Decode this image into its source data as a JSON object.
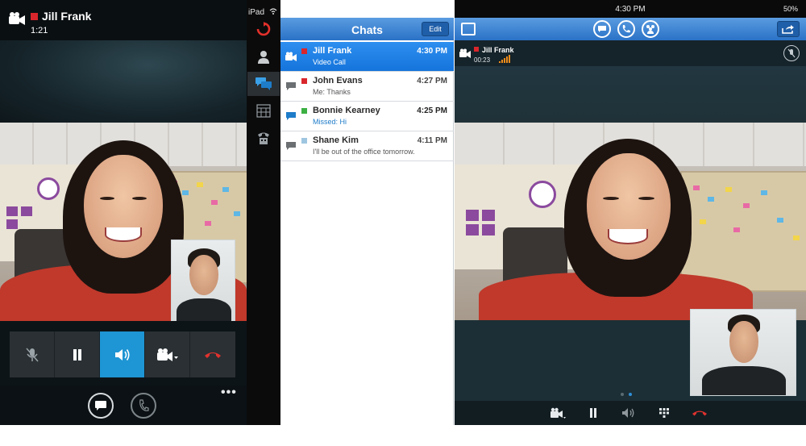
{
  "left_call": {
    "contact_name": "Jill Frank",
    "elapsed": "1:21",
    "status_color": "#d9262c",
    "controls": [
      {
        "id": "mute",
        "icon": "mic-muted-icon",
        "active": false
      },
      {
        "id": "hold",
        "icon": "pause-icon",
        "active": false
      },
      {
        "id": "speaker",
        "icon": "speaker-icon",
        "active": true
      },
      {
        "id": "video",
        "icon": "video-camera-icon",
        "active": false
      },
      {
        "id": "end",
        "icon": "end-call-icon",
        "active": false
      }
    ],
    "bottom": [
      {
        "id": "chat",
        "icon": "chat-bubble-icon"
      },
      {
        "id": "phone",
        "icon": "phone-icon"
      }
    ],
    "more_label": "•••"
  },
  "ipad_sidebar": {
    "device_label": "iPad",
    "items": [
      {
        "id": "refresh",
        "icon": "refresh-icon"
      },
      {
        "id": "contacts",
        "icon": "person-icon"
      },
      {
        "id": "chats",
        "icon": "chats-icon",
        "selected": true
      },
      {
        "id": "calendar",
        "icon": "calendar-icon"
      },
      {
        "id": "phone",
        "icon": "phone-icon"
      }
    ]
  },
  "chats": {
    "title": "Chats",
    "edit_label": "Edit",
    "rows": [
      {
        "name": "Jill Frank",
        "subtitle": "Video Call",
        "time": "4:30 PM",
        "status_color": "#d9262c",
        "icon": "video-camera-icon",
        "selected": true
      },
      {
        "name": "John Evans",
        "subtitle": "Me: Thanks",
        "time": "4:27 PM",
        "status_color": "#d9262c",
        "icon": "chat-bubble-icon",
        "selected": false
      },
      {
        "name": "Bonnie Kearney",
        "subtitle": "Missed: Hi",
        "time": "4:25 PM",
        "status_color": "#3cb043",
        "icon": "chat-bubble-blue-icon",
        "selected": false
      },
      {
        "name": "Shane Kim",
        "subtitle": "I'll be out of the office tomorrow.",
        "time": "4:11 PM",
        "status_color": "#9ec6e0",
        "icon": "chat-bubble-icon",
        "selected": false
      }
    ]
  },
  "right_call": {
    "clock": "4:30 PM",
    "battery": "50%",
    "contact_name": "Jill Frank",
    "elapsed": "00:23",
    "toolbar_icons": [
      "sidebar-toggle-icon",
      "chat-bubble-icon",
      "phone-icon",
      "participants-icon",
      "share-icon"
    ],
    "controls": [
      "video-camera-icon",
      "pause-icon",
      "speaker-icon",
      "keypad-icon",
      "end-call-icon"
    ],
    "page_dots": 2,
    "page_active": 1
  },
  "colors": {
    "accent_blue": "#1e95d4",
    "header_blue": "#2a72c7",
    "end_call_red": "#d9262c"
  }
}
